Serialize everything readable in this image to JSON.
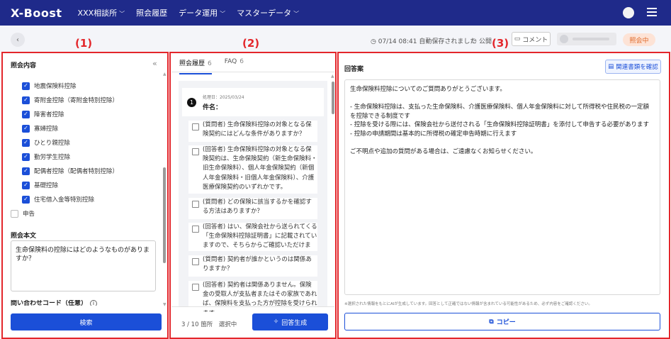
{
  "header": {
    "logo": "X-Boost",
    "nav": [
      {
        "label": "XXX相談所",
        "has_dropdown": true
      },
      {
        "label": "照会履歴",
        "has_dropdown": false
      },
      {
        "label": "データ運用",
        "has_dropdown": true
      },
      {
        "label": "マスターデータ",
        "has_dropdown": true
      }
    ]
  },
  "toolbar": {
    "autosave": "07/14 08:41 自動保存されました",
    "public_label": "公開",
    "comment_label": "コメント",
    "status_badge": "照会中"
  },
  "markers": {
    "p1": "(1)",
    "p2": "(2)",
    "p3": "(3)"
  },
  "panel1": {
    "title": "照会内容",
    "checkboxes": [
      {
        "label": "地震保険料控除",
        "checked": true
      },
      {
        "label": "寄附金控除（寄附金特別控除）",
        "checked": true
      },
      {
        "label": "障害者控除",
        "checked": true
      },
      {
        "label": "寡婦控除",
        "checked": true
      },
      {
        "label": "ひとり親控除",
        "checked": true
      },
      {
        "label": "勤労学生控除",
        "checked": true
      },
      {
        "label": "配偶者控除（配偶者特別控除）",
        "checked": true
      },
      {
        "label": "基礎控除",
        "checked": true
      },
      {
        "label": "住宅借入金等特別控除",
        "checked": true
      },
      {
        "label": "申告",
        "checked": false
      }
    ],
    "question_label": "照会本文",
    "question_text": "生命保険料の控除にはどのようなものがありますか？",
    "code_label": "問い合わせコード（任意）",
    "search_button": "検索"
  },
  "panel2": {
    "tabs": [
      {
        "label": "照会履歴",
        "count": "6",
        "active": true
      },
      {
        "label": "FAQ",
        "count": "6",
        "active": false
      }
    ],
    "history": {
      "number": "1",
      "date": "処理日：2025/03/24",
      "subject": "件名："
    },
    "qa_items": [
      "(質問者) 生命保険料控除の対象となる保険契約にはどんな条件がありますか？",
      "(回答者) 生命保険料控除の対象となる保険契約は、生命保険契約（新生命保険料・旧生命保険料）、個人年金保険契約（新個人年金保険料・旧個人年金保険料）、介護医療保険契約のいずれかです。",
      "(質問者) どの保険に該当するかを確認する方法はありますか？",
      "(回答者) はい、保険会社から送られてくる「生命保険料控除証明書」に記載されていますので、そちらからご確認いただけます。",
      "(質問者) 契約者が誰かというのは関係ありますか？",
      "(回答者) 契約者は関係ありません。保険金の受取人が支払者またはその家族であれば、保険料を支払った方が控除を受けられます。"
    ],
    "selection_status": "3 / 10 箇所　選択中",
    "generate_button": "回答生成"
  },
  "panel3": {
    "title": "回答案",
    "related_button": "関連書類を確認",
    "answer_lines": [
      "生命保険料控除についてのご質問ありがとうございます。",
      "",
      "- 生命保険料控除は、支払った生命保険料、介護医療保険料、個人年金保険料に対して所得税や住民税の一定額を控除できる制度です",
      "- 控除を受ける際には、保険会社から送付される「生命保険料控除証明書」を添付して申告する必要があります",
      "- 控除の申請期間は基本的に所得税の確定申告時期に行えます",
      "",
      "ご不明点や追加の質問がある場合は、ご遠慮なくお知らせください。"
    ],
    "disclaimer": "※選択された情報をもとにAIが生成しています。回答として正確ではない情報が含まれている可能性があるため、必ず内容をご確認ください。",
    "copy_button": "コピー"
  },
  "colors": {
    "brand": "#1f2a8a",
    "primary": "#1b4fd8",
    "highlight": "#e3262b",
    "status": "#e06a2b"
  }
}
